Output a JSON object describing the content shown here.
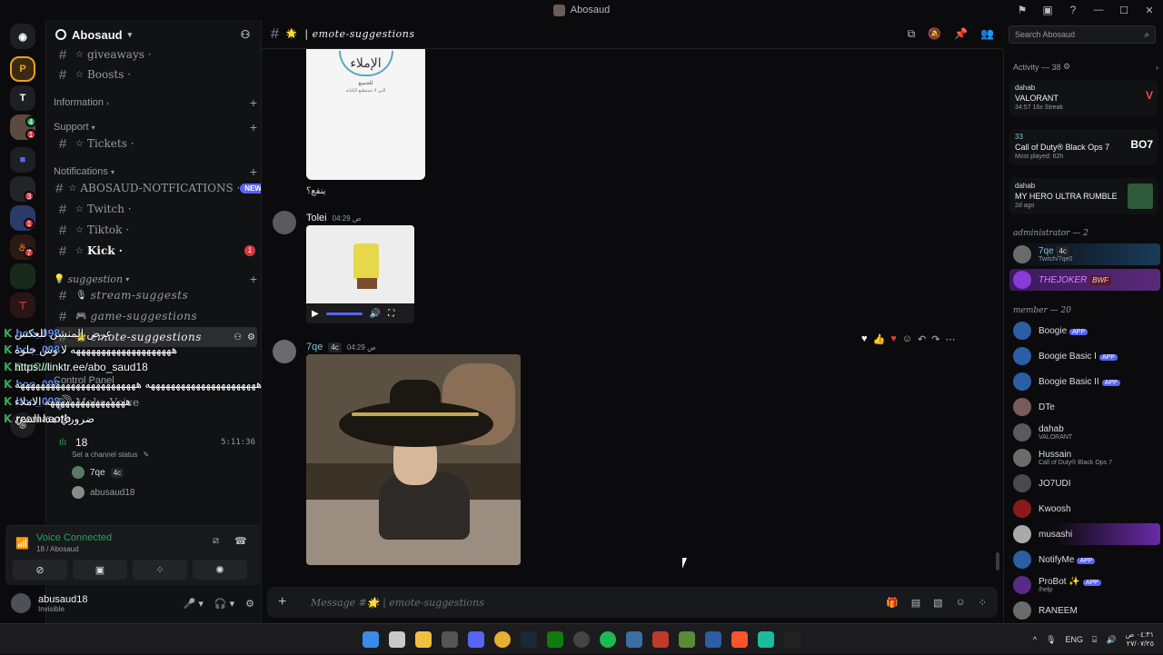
{
  "titlebar": {
    "title": "Abosaud"
  },
  "guild": {
    "name": "Abosaud"
  },
  "sidebar": {
    "channels_top": [
      {
        "name": "giveaways ·"
      },
      {
        "name": "Boosts ·"
      }
    ],
    "cat_information": "Information",
    "cat_support": "Support",
    "ch_tickets": "Tickets ·",
    "cat_notifications": "Notifications",
    "ch_abosaud": "ABOSAUD-NOTFICATIONS ·",
    "new_badge": "NEW",
    "ch_twitch": "Twitch ·",
    "ch_tiktok": "Tiktok ·",
    "ch_kick": "Kick ·",
    "kick_unread": "1",
    "cat_suggestion": "suggestion",
    "ch_stream": "stream-suggests",
    "ch_game": "game-suggestions",
    "ch_emote": "emote-suggestions",
    "cat_control": "Control Panel",
    "ch_makevoice": "Make Voice",
    "voice_channel": "18",
    "voice_timer": "5:11:36",
    "voice_status": "Set a channel status",
    "voice_users": [
      {
        "name": "7qe",
        "tag": "4c"
      },
      {
        "name": "abusaud18"
      }
    ]
  },
  "overlay_chat": [
    {
      "who": "boo_098",
      "color": "#5e8ef7",
      "msg": "عرض المنشن للعكس"
    },
    {
      "who": "boo_098",
      "color": "#5e8ef7",
      "msg": "ههههههههههههههههههههه لا وش جلوه"
    },
    {
      "who": "BotRix",
      "color": "#3ba55c",
      "msg": "https://linktr.ee/abo_saud18"
    },
    {
      "who": "boo_098",
      "color": "#5e8ef7",
      "msg": "ههههههههههههههههههههههه ههههههههههههههههههههههههه"
    },
    {
      "who": "boo_098",
      "color": "#5e8ef7",
      "msg": "ههههههههههههههههه الاملاء"
    },
    {
      "who": "reemasotb",
      "color": "#ffffff",
      "msg": "ضروري هذا الشي"
    }
  ],
  "voice_panel": {
    "title": "Voice Connected",
    "sub": "18 / Abosaud"
  },
  "user": {
    "name": "abusaud18",
    "status": "Invisible"
  },
  "channel": {
    "name": "emote-suggestions"
  },
  "messages": {
    "doc_arabic": "الإملاء",
    "doc_sub": "للجميع",
    "doc_sub2": "التي لا تستطيع الكتابة",
    "caption": "ينفع؟",
    "m1_author": "Tolei",
    "m1_time": "04:29 ص",
    "m2_author": "7qe",
    "m2_tag": "4c",
    "m2_time": "04:29 ص"
  },
  "composer": {
    "placeholder": "Message #🌟 | emote-suggestions"
  },
  "search": {
    "placeholder": "Search Abosaud"
  },
  "activity": {
    "heading": "Activity — 38",
    "cards": [
      {
        "user": "dahab",
        "game": "VALORANT",
        "sub": "34:57  16x Streak",
        "logo": "V"
      },
      {
        "user": "33",
        "game": "Call of Duty® Black Ops 7",
        "sub": "Most played: 62h",
        "logo": "BO7"
      },
      {
        "user": "dahab",
        "game": "MY HERO ULTRA RUMBLE",
        "sub": "2d ago",
        "logo": ""
      }
    ]
  },
  "roles": {
    "admin": "administrator — 2",
    "member": "member — 20"
  },
  "admins": [
    {
      "name": "7qe",
      "sub": "Twitch/7qe0",
      "tag": "4c"
    },
    {
      "name": "THEJOKER",
      "tag": "BWF"
    }
  ],
  "members": [
    {
      "name": "Boogie",
      "app": "APP"
    },
    {
      "name": "Boogie Basic I",
      "app": "APP"
    },
    {
      "name": "Boogie Basic II",
      "app": "APP"
    },
    {
      "name": "DTe"
    },
    {
      "name": "dahab",
      "sub": "VALORANT"
    },
    {
      "name": "Hussain",
      "sub": "Call of Duty® Black Ops 7"
    },
    {
      "name": "JO7UDI"
    },
    {
      "name": "Kwoosh"
    },
    {
      "name": "musashi"
    },
    {
      "name": "NotifyMe",
      "app": "APP"
    },
    {
      "name": "ProBot ✨",
      "app": "APP",
      "sub": "/help"
    },
    {
      "name": "RANEEM"
    }
  ],
  "tray": {
    "lang": "ENG",
    "time": "٠٤:٣١ ص",
    "date": "٢٧/٠٧/٢٥"
  },
  "colors": {
    "accent": "#5865f2",
    "online": "#23a55a",
    "danger": "#da373c"
  }
}
